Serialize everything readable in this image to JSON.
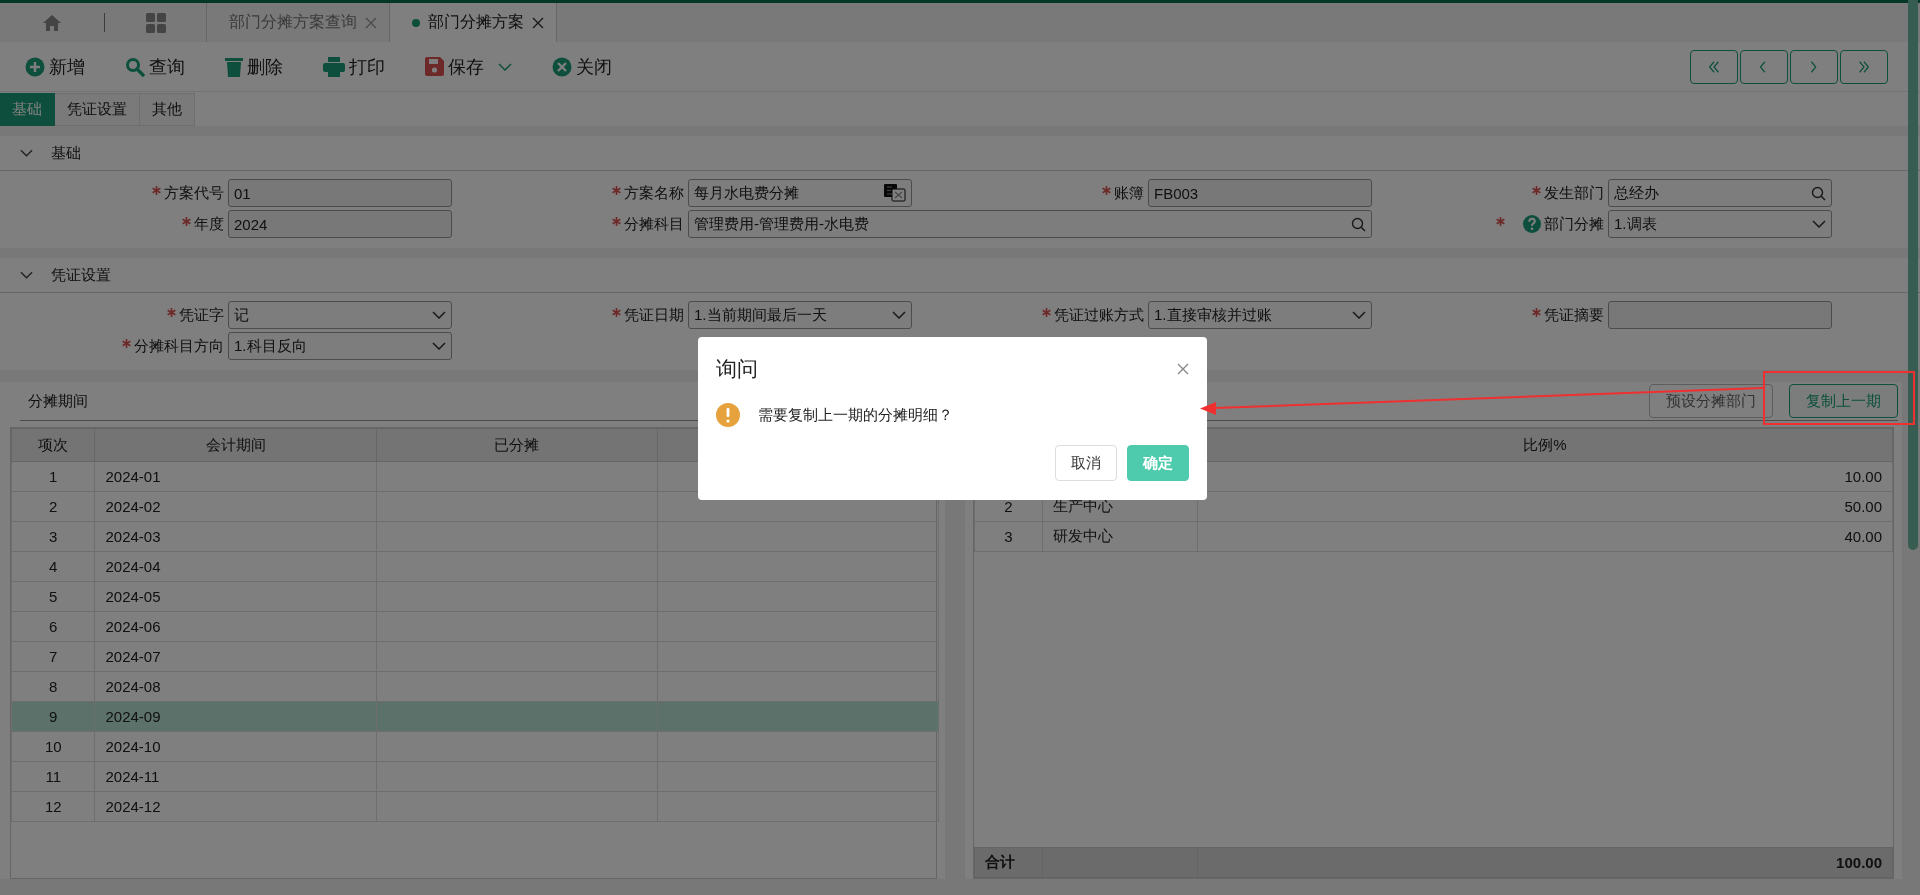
{
  "top_tabs": [
    {
      "label": "部门分摊方案查询",
      "selected": false
    },
    {
      "label": "部门分摊方案",
      "selected": true
    }
  ],
  "toolbar": [
    {
      "label": "新增",
      "kind": "add",
      "dropdown": false
    },
    {
      "label": "查询",
      "kind": "search",
      "dropdown": false
    },
    {
      "label": "删除",
      "kind": "delete",
      "dropdown": false
    },
    {
      "label": "打印",
      "kind": "print",
      "dropdown": false
    },
    {
      "label": "保存",
      "kind": "save",
      "dropdown": true
    },
    {
      "label": "关闭",
      "kind": "close",
      "dropdown": false
    }
  ],
  "form_tabs": [
    {
      "label": "基础",
      "selected": true
    },
    {
      "label": "凭证设置",
      "selected": false
    },
    {
      "label": "其他",
      "selected": false
    }
  ],
  "sections": [
    {
      "title": "基础",
      "expanded": true,
      "fields": [
        {
          "label": "方案代号",
          "required": true,
          "kind": "text",
          "value": "01"
        },
        {
          "label": "方案名称",
          "required": true,
          "kind": "translate",
          "value": "每月水电费分摊"
        },
        {
          "label": "账簿",
          "required": true,
          "kind": "text",
          "value": "FB003"
        },
        {
          "label": "发生部门",
          "required": true,
          "kind": "lookup",
          "value": "总经办"
        },
        {
          "label": "年度",
          "required": true,
          "kind": "text",
          "value": "2024"
        },
        {
          "label": "分摊科目",
          "required": true,
          "kind": "long-lookup",
          "value": "管理费用-管理费用-水电费"
        },
        {
          "label": "部门分摊",
          "required": true,
          "kind": "select",
          "help": true,
          "value": "1.调表"
        }
      ]
    },
    {
      "title": "凭证设置",
      "expanded": true,
      "fields": [
        {
          "label": "凭证字",
          "required": true,
          "kind": "select",
          "value": "记"
        },
        {
          "label": "凭证日期",
          "required": true,
          "kind": "select",
          "value": "1.当前期间最后一天"
        },
        {
          "label": "凭证过账方式",
          "required": true,
          "kind": "select",
          "value": "1.直接审核并过账"
        },
        {
          "label": "凭证摘要",
          "required": true,
          "kind": "text"
        },
        {
          "label": "分摊科目方向",
          "required": true,
          "kind": "select",
          "value": "1.科目反向"
        }
      ]
    }
  ],
  "periods": {
    "title": "分摊期间",
    "columns": [
      "项次",
      "会计期间",
      "已分摊"
    ],
    "rows": [
      {
        "index": "1",
        "period": "2024-01",
        "selected": false
      },
      {
        "index": "2",
        "period": "2024-02",
        "selected": false
      },
      {
        "index": "3",
        "period": "2024-03",
        "selected": false
      },
      {
        "index": "4",
        "period": "2024-04",
        "selected": false
      },
      {
        "index": "5",
        "period": "2024-05",
        "selected": false
      },
      {
        "index": "6",
        "period": "2024-06",
        "selected": false
      },
      {
        "index": "7",
        "period": "2024-07",
        "selected": false
      },
      {
        "index": "8",
        "period": "2024-08",
        "selected": false
      },
      {
        "index": "9",
        "period": "2024-09",
        "selected": true
      },
      {
        "index": "10",
        "period": "2024-10",
        "selected": false
      },
      {
        "index": "11",
        "period": "2024-11",
        "selected": false
      },
      {
        "index": "12",
        "period": "2024-12",
        "selected": false
      }
    ]
  },
  "details": {
    "buttons": [
      {
        "label": "预设分摊部门",
        "kind": "plain"
      },
      {
        "label": "复制上一期",
        "kind": "primary"
      }
    ],
    "ratio_column": "比例%",
    "rows": [
      {
        "ratio": "10.00"
      },
      {
        "index": "2",
        "name": "生产中心",
        "ratio": "50.00"
      },
      {
        "index": "3",
        "name": "研发中心",
        "ratio": "40.00"
      }
    ],
    "total": {
      "label": "合计",
      "ratio": "100.00"
    }
  },
  "dialog": {
    "title": "询问",
    "message": "需要复制上一期的分摊明细？",
    "buttons": [
      {
        "label": "取消",
        "kind": "default"
      },
      {
        "label": "确定",
        "kind": "primary"
      }
    ]
  }
}
